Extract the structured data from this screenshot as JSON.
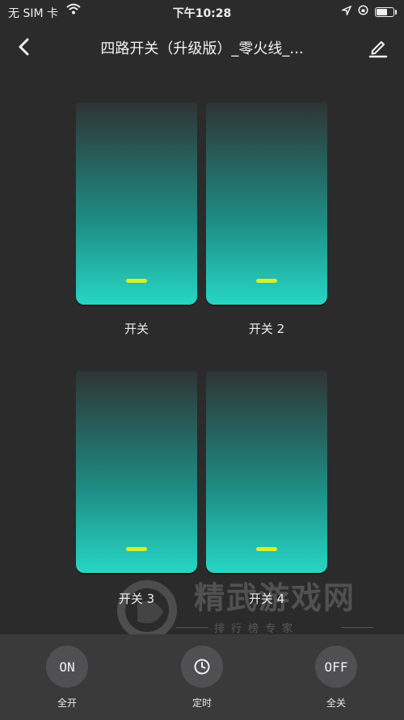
{
  "status_bar": {
    "carrier": "无 SIM 卡",
    "time": "下午10:28"
  },
  "nav": {
    "title": "四路开关（升级版）_零火线_..."
  },
  "switches": [
    {
      "label": "开关"
    },
    {
      "label": "开关 2"
    },
    {
      "label": "开关 3"
    },
    {
      "label": "开关 4"
    }
  ],
  "colors": {
    "background": "#2b2b2c",
    "panel_top": "#2f3434",
    "panel_bottom": "#26d6c4",
    "indicator": "#d7f02a",
    "bottom_bar": "#3a3a3b"
  },
  "watermark": {
    "title": "精武游戏网",
    "subtitle": "排行榜专家"
  },
  "actions": [
    {
      "icon_text": "ON",
      "label": "全开"
    },
    {
      "icon": "clock-icon",
      "label": "定时"
    },
    {
      "icon_text": "OFF",
      "label": "全关"
    }
  ]
}
